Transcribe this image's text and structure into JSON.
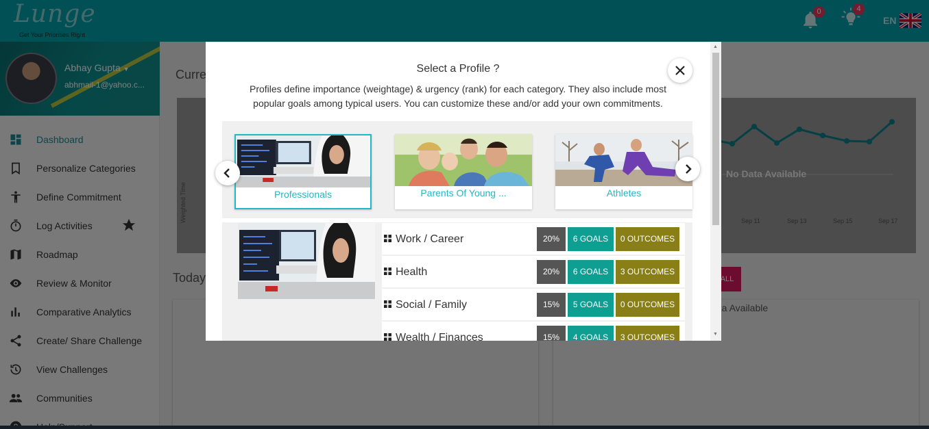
{
  "header": {
    "logo_text": "Lunge",
    "logo_tagline": "Get Your Priorities Right",
    "notifications_count": "0",
    "alerts_count": "4",
    "language": "EN",
    "accent_color": "#00a0ac"
  },
  "sidebar": {
    "user_name": "Abhay Gupta",
    "user_email": "abhmail-1@yahoo.c...",
    "items": [
      {
        "label": "Dashboard",
        "icon": "dashboard-icon"
      },
      {
        "label": "Personalize Categories",
        "icon": "bookmark-icon"
      },
      {
        "label": "Define Commitment",
        "icon": "person-icon"
      },
      {
        "label": "Log Activities",
        "icon": "timer-icon"
      },
      {
        "label": "Roadmap",
        "icon": "map-icon"
      },
      {
        "label": "Review & Monitor",
        "icon": "eye-icon"
      },
      {
        "label": "Comparative Analytics",
        "icon": "bar-chart-icon"
      },
      {
        "label": "Create/ Share Challenge",
        "icon": "share-icon"
      },
      {
        "label": "View Challenges",
        "icon": "history-icon"
      },
      {
        "label": "Communities",
        "icon": "group-icon"
      },
      {
        "label": "Help/Support",
        "icon": "help-icon"
      }
    ]
  },
  "main": {
    "current_title": "Curre",
    "today_title": "Today",
    "chart_ylabel": "Weighted Time",
    "chart_nodata": "No Data Available",
    "chart_xticks": [
      "Sep 11",
      "Sep 13",
      "Sep 15",
      "Sep 17"
    ],
    "all_button": "ALL",
    "nodata_partial": "ata Available"
  },
  "modal": {
    "title": "Select a Profile ?",
    "description": "Profiles define importance (weightage) & urgency (rank) for each category. They also include most popular goals among typical users. You can customize these and/or add your own commitments.",
    "profiles": [
      {
        "label": "Professionals",
        "selected": true
      },
      {
        "label": "Parents Of Young ...",
        "selected": false
      },
      {
        "label": "Athletes",
        "selected": false
      }
    ],
    "categories": [
      {
        "name": "Work / Career",
        "weight": "20%",
        "goals": "6 GOALS",
        "outcomes": "0 OUTCOMES"
      },
      {
        "name": "Health",
        "weight": "20%",
        "goals": "6 GOALS",
        "outcomes": "3 OUTCOMES"
      },
      {
        "name": "Social / Family",
        "weight": "15%",
        "goals": "5 GOALS",
        "outcomes": "0 OUTCOMES"
      },
      {
        "name": "Wealth / Finances",
        "weight": "15%",
        "goals": "4 GOALS",
        "outcomes": "3 OUTCOMES"
      }
    ]
  }
}
